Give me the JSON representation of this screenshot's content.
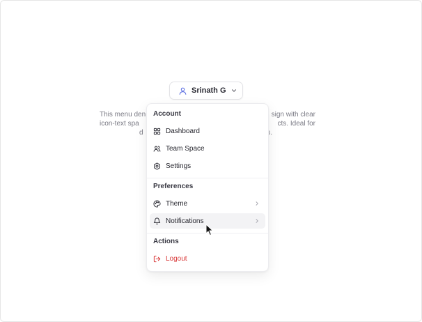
{
  "user": {
    "name": "Srinath G"
  },
  "description": {
    "lines": [
      "This menu den",
      "sign with clear",
      "icon-text spa",
      "cts. Ideal for",
      "d",
      "s."
    ]
  },
  "menu": {
    "sections": [
      {
        "label": "Account",
        "items": [
          {
            "label": "Dashboard",
            "icon": "dashboard-icon"
          },
          {
            "label": "Team Space",
            "icon": "users-icon"
          },
          {
            "label": "Settings",
            "icon": "settings-icon"
          }
        ]
      },
      {
        "label": "Preferences",
        "items": [
          {
            "label": "Theme",
            "icon": "palette-icon",
            "submenu": true
          },
          {
            "label": "Notifications",
            "icon": "bell-icon",
            "submenu": true,
            "hovered": true
          }
        ]
      },
      {
        "label": "Actions",
        "items": [
          {
            "label": "Logout",
            "icon": "logout-icon",
            "danger": true
          }
        ]
      }
    ]
  },
  "colors": {
    "accent": "#5b6ee1",
    "danger": "#d93a3a",
    "hover_bg": "#f3f3f5"
  }
}
